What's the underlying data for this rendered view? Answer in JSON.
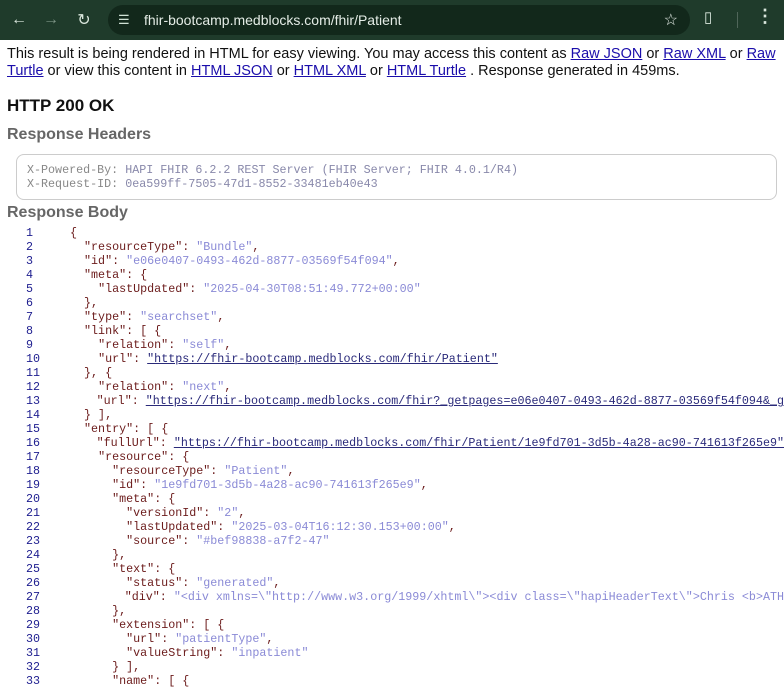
{
  "browser": {
    "url": "fhir-bootcamp.medblocks.com/fhir/Patient",
    "icons": [
      "back-icon",
      "forward-icon",
      "reload-icon",
      "site-settings-icon",
      "star-icon",
      "extensions-icon",
      "menu-icon"
    ]
  },
  "intro": {
    "t1": "This result is being rendered in HTML for easy viewing. You may access this content as ",
    "raw_json": "Raw JSON",
    "or1": " or ",
    "raw_xml": "Raw XML",
    "or2": " or ",
    "raw_turtle": "Raw Turtle",
    "t2": " or view this content in ",
    "html_json": "HTML JSON",
    "or3": " or ",
    "html_xml": "HTML XML",
    "or4": " or ",
    "html_turtle": "HTML Turtle",
    "t3": " . Response generated in 459ms."
  },
  "status": "HTTP 200 OK",
  "headers_title": "Response Headers",
  "headers": [
    {
      "key": "X-Powered-By: ",
      "value": "HAPI FHIR 6.2.2 REST Server (FHIR Server; FHIR 4.0.1/R4)"
    },
    {
      "key": "X-Request-ID: ",
      "value": "0ea599ff-7505-47d1-8552-33481eb40e43"
    }
  ],
  "body_title": "Response Body",
  "code": [
    {
      "n": "1",
      "t": [
        [
          "p",
          "{"
        ]
      ]
    },
    {
      "n": "2",
      "t": [
        [
          "p",
          "  "
        ],
        [
          "k",
          "\"resourceType\""
        ],
        [
          "p",
          ": "
        ],
        [
          "s",
          "\"Bundle\""
        ],
        [
          "p",
          ","
        ]
      ]
    },
    {
      "n": "3",
      "t": [
        [
          "p",
          "  "
        ],
        [
          "k",
          "\"id\""
        ],
        [
          "p",
          ": "
        ],
        [
          "s",
          "\"e06e0407-0493-462d-8877-03569f54f094\""
        ],
        [
          "p",
          ","
        ]
      ]
    },
    {
      "n": "4",
      "t": [
        [
          "p",
          "  "
        ],
        [
          "k",
          "\"meta\""
        ],
        [
          "p",
          ": {"
        ]
      ]
    },
    {
      "n": "5",
      "t": [
        [
          "p",
          "    "
        ],
        [
          "k",
          "\"lastUpdated\""
        ],
        [
          "p",
          ": "
        ],
        [
          "s",
          "\"2025-04-30T08:51:49.772+00:00\""
        ]
      ]
    },
    {
      "n": "6",
      "t": [
        [
          "p",
          "  },"
        ]
      ]
    },
    {
      "n": "7",
      "t": [
        [
          "p",
          "  "
        ],
        [
          "k",
          "\"type\""
        ],
        [
          "p",
          ": "
        ],
        [
          "s",
          "\"searchset\""
        ],
        [
          "p",
          ","
        ]
      ]
    },
    {
      "n": "8",
      "t": [
        [
          "p",
          "  "
        ],
        [
          "k",
          "\"link\""
        ],
        [
          "p",
          ": [ {"
        ]
      ]
    },
    {
      "n": "9",
      "t": [
        [
          "p",
          "    "
        ],
        [
          "k",
          "\"relation\""
        ],
        [
          "p",
          ": "
        ],
        [
          "s",
          "\"self\""
        ],
        [
          "p",
          ","
        ]
      ]
    },
    {
      "n": "10",
      "t": [
        [
          "p",
          "    "
        ],
        [
          "k",
          "\"url\""
        ],
        [
          "p",
          ": "
        ],
        [
          "u",
          "\"https://fhir-bootcamp.medblocks.com/fhir/Patient\""
        ]
      ]
    },
    {
      "n": "11",
      "t": [
        [
          "p",
          "  }, {"
        ]
      ]
    },
    {
      "n": "12",
      "t": [
        [
          "p",
          "    "
        ],
        [
          "k",
          "\"relation\""
        ],
        [
          "p",
          ": "
        ],
        [
          "s",
          "\"next\""
        ],
        [
          "p",
          ","
        ]
      ]
    },
    {
      "n": "13",
      "t": [
        [
          "p",
          "    "
        ],
        [
          "k",
          "\"url\""
        ],
        [
          "p",
          ": "
        ],
        [
          "u",
          "\"https://fhir-bootcamp.medblocks.com/fhir?_getpages=e06e0407-0493-462d-8877-03569f54f094&_g"
        ]
      ]
    },
    {
      "n": "14",
      "t": [
        [
          "p",
          "  } ],"
        ]
      ]
    },
    {
      "n": "15",
      "t": [
        [
          "p",
          "  "
        ],
        [
          "k",
          "\"entry\""
        ],
        [
          "p",
          ": [ {"
        ]
      ]
    },
    {
      "n": "16",
      "t": [
        [
          "p",
          "    "
        ],
        [
          "k",
          "\"fullUrl\""
        ],
        [
          "p",
          ": "
        ],
        [
          "u",
          "\"https://fhir-bootcamp.medblocks.com/fhir/Patient/1e9fd701-3d5b-4a28-ac90-741613f265e9\""
        ]
      ]
    },
    {
      "n": "17",
      "t": [
        [
          "p",
          "    "
        ],
        [
          "k",
          "\"resource\""
        ],
        [
          "p",
          ": {"
        ]
      ]
    },
    {
      "n": "18",
      "t": [
        [
          "p",
          "      "
        ],
        [
          "k",
          "\"resourceType\""
        ],
        [
          "p",
          ": "
        ],
        [
          "s",
          "\"Patient\""
        ],
        [
          "p",
          ","
        ]
      ]
    },
    {
      "n": "19",
      "t": [
        [
          "p",
          "      "
        ],
        [
          "k",
          "\"id\""
        ],
        [
          "p",
          ": "
        ],
        [
          "s",
          "\"1e9fd701-3d5b-4a28-ac90-741613f265e9\""
        ],
        [
          "p",
          ","
        ]
      ]
    },
    {
      "n": "20",
      "t": [
        [
          "p",
          "      "
        ],
        [
          "k",
          "\"meta\""
        ],
        [
          "p",
          ": {"
        ]
      ]
    },
    {
      "n": "21",
      "t": [
        [
          "p",
          "        "
        ],
        [
          "k",
          "\"versionId\""
        ],
        [
          "p",
          ": "
        ],
        [
          "s",
          "\"2\""
        ],
        [
          "p",
          ","
        ]
      ]
    },
    {
      "n": "22",
      "t": [
        [
          "p",
          "        "
        ],
        [
          "k",
          "\"lastUpdated\""
        ],
        [
          "p",
          ": "
        ],
        [
          "s",
          "\"2025-03-04T16:12:30.153+00:00\""
        ],
        [
          "p",
          ","
        ]
      ]
    },
    {
      "n": "23",
      "t": [
        [
          "p",
          "        "
        ],
        [
          "k",
          "\"source\""
        ],
        [
          "p",
          ": "
        ],
        [
          "s",
          "\"#bef98838-a7f2-47\""
        ]
      ]
    },
    {
      "n": "24",
      "t": [
        [
          "p",
          "      },"
        ]
      ]
    },
    {
      "n": "25",
      "t": [
        [
          "p",
          "      "
        ],
        [
          "k",
          "\"text\""
        ],
        [
          "p",
          ": {"
        ]
      ]
    },
    {
      "n": "26",
      "t": [
        [
          "p",
          "        "
        ],
        [
          "k",
          "\"status\""
        ],
        [
          "p",
          ": "
        ],
        [
          "s",
          "\"generated\""
        ],
        [
          "p",
          ","
        ]
      ]
    },
    {
      "n": "27",
      "t": [
        [
          "p",
          "        "
        ],
        [
          "k",
          "\"div\""
        ],
        [
          "p",
          ": "
        ],
        [
          "s",
          "\"<div xmlns=\\\"http://www.w3.org/1999/xhtml\\\"><div class=\\\"hapiHeaderText\\\">Chris <b>ATH"
        ]
      ]
    },
    {
      "n": "28",
      "t": [
        [
          "p",
          "      },"
        ]
      ]
    },
    {
      "n": "29",
      "t": [
        [
          "p",
          "      "
        ],
        [
          "k",
          "\"extension\""
        ],
        [
          "p",
          ": [ {"
        ]
      ]
    },
    {
      "n": "30",
      "t": [
        [
          "p",
          "        "
        ],
        [
          "k",
          "\"url\""
        ],
        [
          "p",
          ": "
        ],
        [
          "s",
          "\"patientType\""
        ],
        [
          "p",
          ","
        ]
      ]
    },
    {
      "n": "31",
      "t": [
        [
          "p",
          "        "
        ],
        [
          "k",
          "\"valueString\""
        ],
        [
          "p",
          ": "
        ],
        [
          "s",
          "\"inpatient\""
        ]
      ]
    },
    {
      "n": "32",
      "t": [
        [
          "p",
          "      } ],"
        ]
      ]
    },
    {
      "n": "33",
      "t": [
        [
          "p",
          "      "
        ],
        [
          "k",
          "\"name\""
        ],
        [
          "p",
          ": [ {"
        ]
      ]
    }
  ],
  "colors": {
    "toolbar": "#1f3b2b",
    "key": "#6b1b1b",
    "string": "#8a8ad6",
    "link": "#1a0dab",
    "line_number": "#1d1d8f"
  }
}
